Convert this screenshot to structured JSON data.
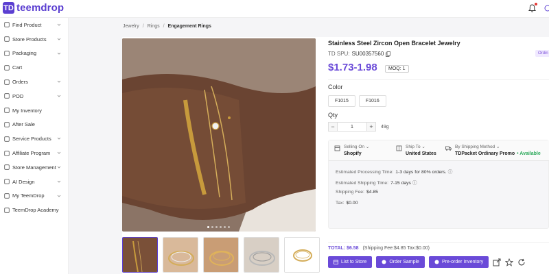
{
  "brand": {
    "logo_mark": "TD",
    "name": "teemdrop",
    "accent": "#5b3fd1"
  },
  "sidebar": {
    "items": [
      {
        "label": "Find Product",
        "icon": "search-icon",
        "has_chevron": true
      },
      {
        "label": "Store Products",
        "icon": "store-icon",
        "has_chevron": true
      },
      {
        "label": "Packaging",
        "icon": "tag-icon",
        "has_chevron": true
      },
      {
        "label": "Cart",
        "icon": "cart-icon",
        "has_chevron": false
      },
      {
        "label": "Orders",
        "icon": "orders-icon",
        "has_chevron": true
      },
      {
        "label": "POD",
        "icon": "pod-icon",
        "has_chevron": true
      },
      {
        "label": "My Inventory",
        "icon": "inventory-icon",
        "has_chevron": false
      },
      {
        "label": "After Sale",
        "icon": "after-sale-icon",
        "has_chevron": false
      },
      {
        "label": "Service Products",
        "icon": "service-icon",
        "has_chevron": true
      },
      {
        "label": "Affiliate Program",
        "icon": "affiliate-icon",
        "has_chevron": true
      },
      {
        "label": "Store Management",
        "icon": "store-management-icon",
        "has_chevron": true
      },
      {
        "label": "AI Design",
        "icon": "ai-design-icon",
        "has_chevron": true
      },
      {
        "label": "My TeemDrop",
        "icon": "user-icon",
        "has_chevron": true
      },
      {
        "label": "TeemDrop Academy",
        "icon": "academy-icon",
        "has_chevron": false
      }
    ]
  },
  "breadcrumb": {
    "items": [
      "Jewelry",
      "Rings"
    ],
    "current": "Engagement Rings"
  },
  "product": {
    "title": "Stainless Steel Zircon Open Bracelet Jewelry",
    "spu_label": "TD SPU:",
    "spu_value": "SU00357560",
    "badge": "Ordin",
    "price": "$1.73-1.98",
    "moq": "MOQ: 1",
    "color_label": "Color",
    "colors": [
      "F1015",
      "F1016"
    ],
    "qty_label": "Qty",
    "qty_value": "1",
    "weight": "49g",
    "image_dots": 6,
    "image_dot_active": 0
  },
  "shipping": {
    "selling_on_label": "Selling On",
    "selling_on_value": "Shopify",
    "ship_to_label": "Ship To",
    "ship_to_value": "United States",
    "method_label": "By Shipping Method",
    "method_value": "TDPacket Ordinary Promo",
    "available": "Available",
    "processing_label": "Estimated Processing Time:",
    "processing_value": "1-3 days for 80% orders.",
    "shipping_time_label": "Estimated Shipping Time:",
    "shipping_time_value": "7-15 days",
    "fee_label": "Shipping Fee:",
    "fee_value": "$4.85",
    "tax_label": "Tax:",
    "tax_value": "$0.00"
  },
  "summary": {
    "total_label": "TOTAL:",
    "total_value": "$6.58",
    "breakdown": "(Shipping Fee:$4.85   Tax:$0.00)"
  },
  "actions": {
    "list_to_store": "List to Store",
    "order_sample": "Order Sample",
    "preorder_inventory": "Pre-order Inventory"
  },
  "colors": {
    "accent": "#6a4ad8",
    "available": "#2eaa5c",
    "notification": "#e53935"
  }
}
